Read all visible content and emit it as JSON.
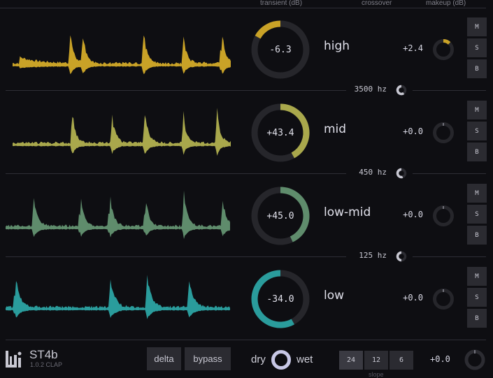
{
  "header": {
    "transient": "transient (dB)",
    "crossover": "crossover",
    "makeup": "makeup (dB)"
  },
  "bands": [
    {
      "name": "high",
      "transient": "-6.3",
      "transient_fraction": -0.17,
      "makeup": "+2.4",
      "makeup_fraction": 0.12,
      "color": "#c9a227",
      "mute": "M",
      "solo": "S",
      "bypass": "B"
    },
    {
      "name": "mid",
      "transient": "+43.4",
      "transient_fraction": 0.42,
      "makeup": "+0.0",
      "makeup_fraction": 0,
      "color": "#a9a84c",
      "mute": "M",
      "solo": "S",
      "bypass": "B"
    },
    {
      "name": "low-mid",
      "transient": "+45.0",
      "transient_fraction": 0.43,
      "makeup": "+0.0",
      "makeup_fraction": 0,
      "color": "#5f8c6c",
      "mute": "M",
      "solo": "S",
      "bypass": "B"
    },
    {
      "name": "low",
      "transient": "-34.0",
      "transient_fraction": -0.58,
      "makeup": "+0.0",
      "makeup_fraction": 0,
      "color": "#2a9c9c",
      "mute": "M",
      "solo": "S",
      "bypass": "B"
    }
  ],
  "crossovers": [
    "3500 hz",
    "450 hz",
    "125 hz"
  ],
  "footer": {
    "product": "ST4b",
    "version": "1.0.2 CLAP",
    "delta": "delta",
    "bypass": "bypass",
    "dry": "dry",
    "wet": "wet",
    "slopes": [
      "24",
      "12",
      "6"
    ],
    "slope_label": "slope",
    "selected_slope": "24",
    "output": "+0.0"
  }
}
